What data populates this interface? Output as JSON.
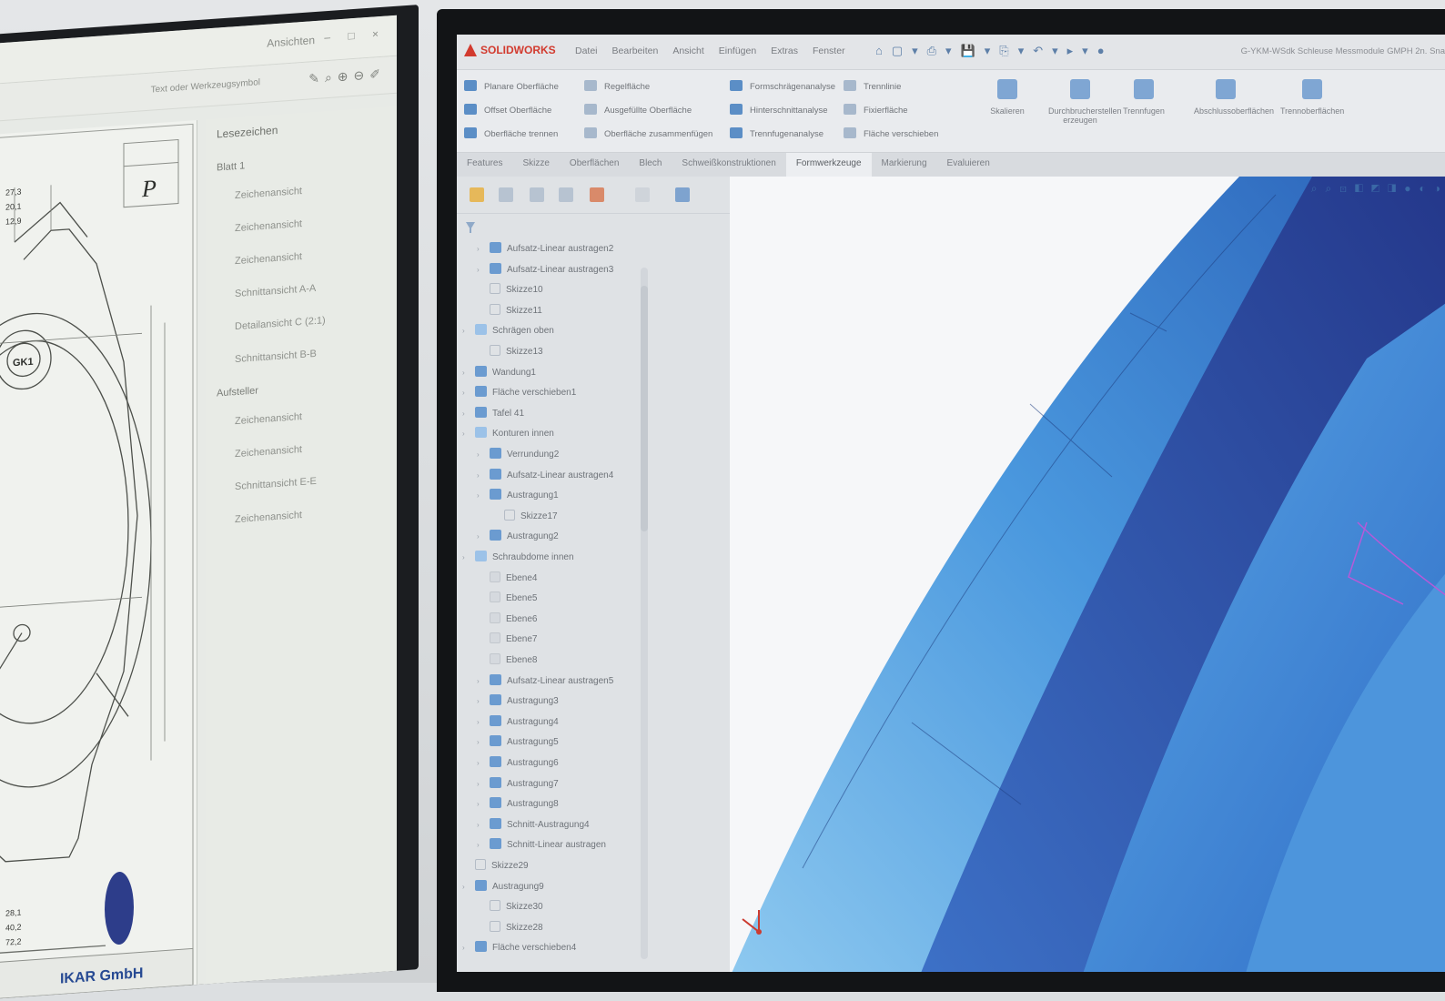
{
  "left_app": {
    "window_title": "Ansichten",
    "toolbar_label": "Text oder Werkzeugsymbol",
    "panel_header": "Lesezeichen",
    "panel_items": [
      {
        "label": "Blatt 1",
        "indent": 0
      },
      {
        "label": "Zeichenansicht",
        "indent": 1
      },
      {
        "label": "Zeichenansicht",
        "indent": 1
      },
      {
        "label": "Zeichenansicht",
        "indent": 1
      },
      {
        "label": "Schnittansicht A-A",
        "indent": 1
      },
      {
        "label": "Detailansicht C (2:1)",
        "indent": 1
      },
      {
        "label": "Schnittansicht B-B",
        "indent": 1
      },
      {
        "label": "Aufsteller",
        "indent": 0
      },
      {
        "label": "Zeichenansicht",
        "indent": 1
      },
      {
        "label": "Zeichenansicht",
        "indent": 1
      },
      {
        "label": "Schnittansicht E-E",
        "indent": 1
      },
      {
        "label": "Zeichenansicht",
        "indent": 1
      }
    ],
    "drawing": {
      "company": "IKAR GmbH",
      "revision_mark": "P",
      "center_label": "GK1",
      "dims": [
        "27,3",
        "20,1",
        "12,9",
        "28,1",
        "40,2",
        "72,2"
      ]
    }
  },
  "sw": {
    "logo_text": "SOLIDWORKS",
    "menus": [
      "Datei",
      "Bearbeiten",
      "Ansicht",
      "Einfügen",
      "Extras",
      "Fenster"
    ],
    "doc_title": "G-YKM-WSdk Schleuse Messmodule GMPH 2n. Sna",
    "ribbon_col1": [
      "Planare Oberfläche",
      "Offset Oberfläche",
      "Oberfläche trennen"
    ],
    "ribbon_col2": [
      "Regelfläche",
      "Ausgefüllte Oberfläche",
      "Oberfläche zusammenfügen"
    ],
    "ribbon_col3": [
      "Formschrägenanalyse",
      "Hinterschnittanalyse",
      "Trennfugenanalyse"
    ],
    "ribbon_col4": [
      "Trennlinie",
      "Fixierfläche",
      "Fläche verschieben"
    ],
    "ribbon_big": [
      "Skalieren",
      "Durchbrucherstellen erzeugen",
      "Trennfugen",
      "Abschlussoberflächen",
      "Trennoberflächen"
    ],
    "tabs": [
      "Features",
      "Skizze",
      "Oberflächen",
      "Blech",
      "Schweißkonstruktionen",
      "Formwerkzeuge",
      "Markierung",
      "Evaluieren"
    ],
    "active_tab": "Formwerkzeuge",
    "tree": [
      {
        "label": "Aufsatz-Linear austragen2",
        "depth": 1,
        "icon": "feature"
      },
      {
        "label": "Aufsatz-Linear austragen3",
        "depth": 1,
        "icon": "feature"
      },
      {
        "label": "Skizze10",
        "depth": 1,
        "icon": "none"
      },
      {
        "label": "Skizze11",
        "depth": 1,
        "icon": "none"
      },
      {
        "label": "Schrägen oben",
        "depth": 0,
        "icon": "folder"
      },
      {
        "label": "Skizze13",
        "depth": 1,
        "icon": "none"
      },
      {
        "label": "Wandung1",
        "depth": 0,
        "icon": "feature"
      },
      {
        "label": "Fläche verschieben1",
        "depth": 0,
        "icon": "feature"
      },
      {
        "label": "Tafel 41",
        "depth": 0,
        "icon": "feature"
      },
      {
        "label": "Konturen innen",
        "depth": 0,
        "icon": "folder"
      },
      {
        "label": "Verrundung2",
        "depth": 1,
        "icon": "feature"
      },
      {
        "label": "Aufsatz-Linear austragen4",
        "depth": 1,
        "icon": "feature"
      },
      {
        "label": "Austragung1",
        "depth": 1,
        "icon": "feature"
      },
      {
        "label": "Skizze17",
        "depth": 2,
        "icon": "sketch"
      },
      {
        "label": "Austragung2",
        "depth": 1,
        "icon": "feature"
      },
      {
        "label": "Schraubdome innen",
        "depth": 0,
        "icon": "folder"
      },
      {
        "label": "Ebene4",
        "depth": 1,
        "icon": "plane"
      },
      {
        "label": "Ebene5",
        "depth": 1,
        "icon": "plane"
      },
      {
        "label": "Ebene6",
        "depth": 1,
        "icon": "plane"
      },
      {
        "label": "Ebene7",
        "depth": 1,
        "icon": "plane"
      },
      {
        "label": "Ebene8",
        "depth": 1,
        "icon": "plane"
      },
      {
        "label": "Aufsatz-Linear austragen5",
        "depth": 1,
        "icon": "feature"
      },
      {
        "label": "Austragung3",
        "depth": 1,
        "icon": "feature"
      },
      {
        "label": "Austragung4",
        "depth": 1,
        "icon": "feature"
      },
      {
        "label": "Austragung5",
        "depth": 1,
        "icon": "feature"
      },
      {
        "label": "Austragung6",
        "depth": 1,
        "icon": "feature"
      },
      {
        "label": "Austragung7",
        "depth": 1,
        "icon": "feature"
      },
      {
        "label": "Austragung8",
        "depth": 1,
        "icon": "feature"
      },
      {
        "label": "Schnitt-Austragung4",
        "depth": 1,
        "icon": "feature"
      },
      {
        "label": "Schnitt-Linear austragen",
        "depth": 1,
        "icon": "feature"
      },
      {
        "label": "Skizze29",
        "depth": 0,
        "icon": "sketch"
      },
      {
        "label": "Austragung9",
        "depth": 0,
        "icon": "feature"
      },
      {
        "label": "Skizze30",
        "depth": 1,
        "icon": "sketch"
      },
      {
        "label": "Skizze28",
        "depth": 1,
        "icon": "sketch"
      },
      {
        "label": "Fläche verschieben4",
        "depth": 0,
        "icon": "feature"
      }
    ]
  },
  "colors": {
    "model_light": "#6fb8ea",
    "model_mid": "#3f7fd0",
    "model_dark": "#273f8e",
    "sw_accent": "#d23a2e"
  }
}
